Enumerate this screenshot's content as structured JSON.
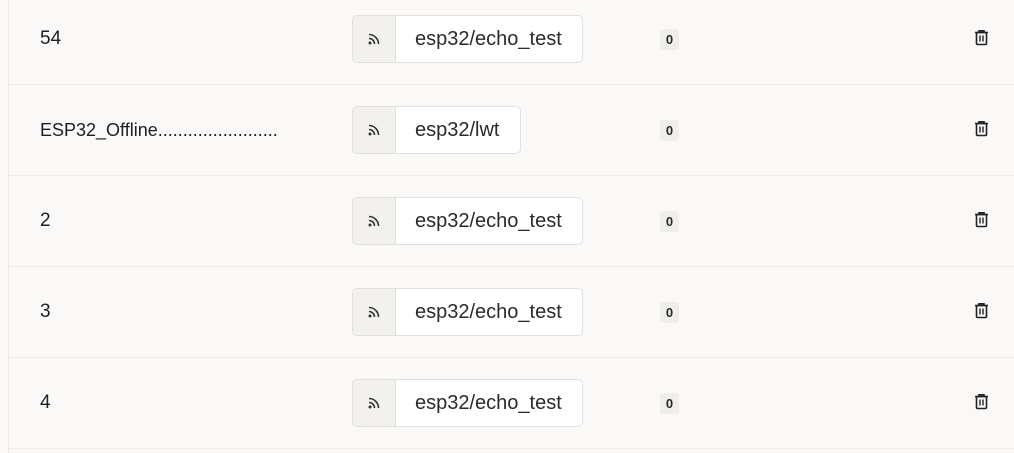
{
  "messages": [
    {
      "payload": "54",
      "topic": "esp32/echo_test",
      "qos": "0",
      "icon": "rss-icon",
      "action_icon": "trash-icon"
    },
    {
      "payload": "ESP32_Offline........................",
      "topic": "esp32/lwt",
      "qos": "0",
      "icon": "rss-icon",
      "action_icon": "trash-icon"
    },
    {
      "payload": "2",
      "topic": "esp32/echo_test",
      "qos": "0",
      "icon": "rss-icon",
      "action_icon": "trash-icon"
    },
    {
      "payload": "3",
      "topic": "esp32/echo_test",
      "qos": "0",
      "icon": "rss-icon",
      "action_icon": "trash-icon"
    },
    {
      "payload": "4",
      "topic": "esp32/echo_test",
      "qos": "0",
      "icon": "rss-icon",
      "action_icon": "trash-icon"
    }
  ]
}
